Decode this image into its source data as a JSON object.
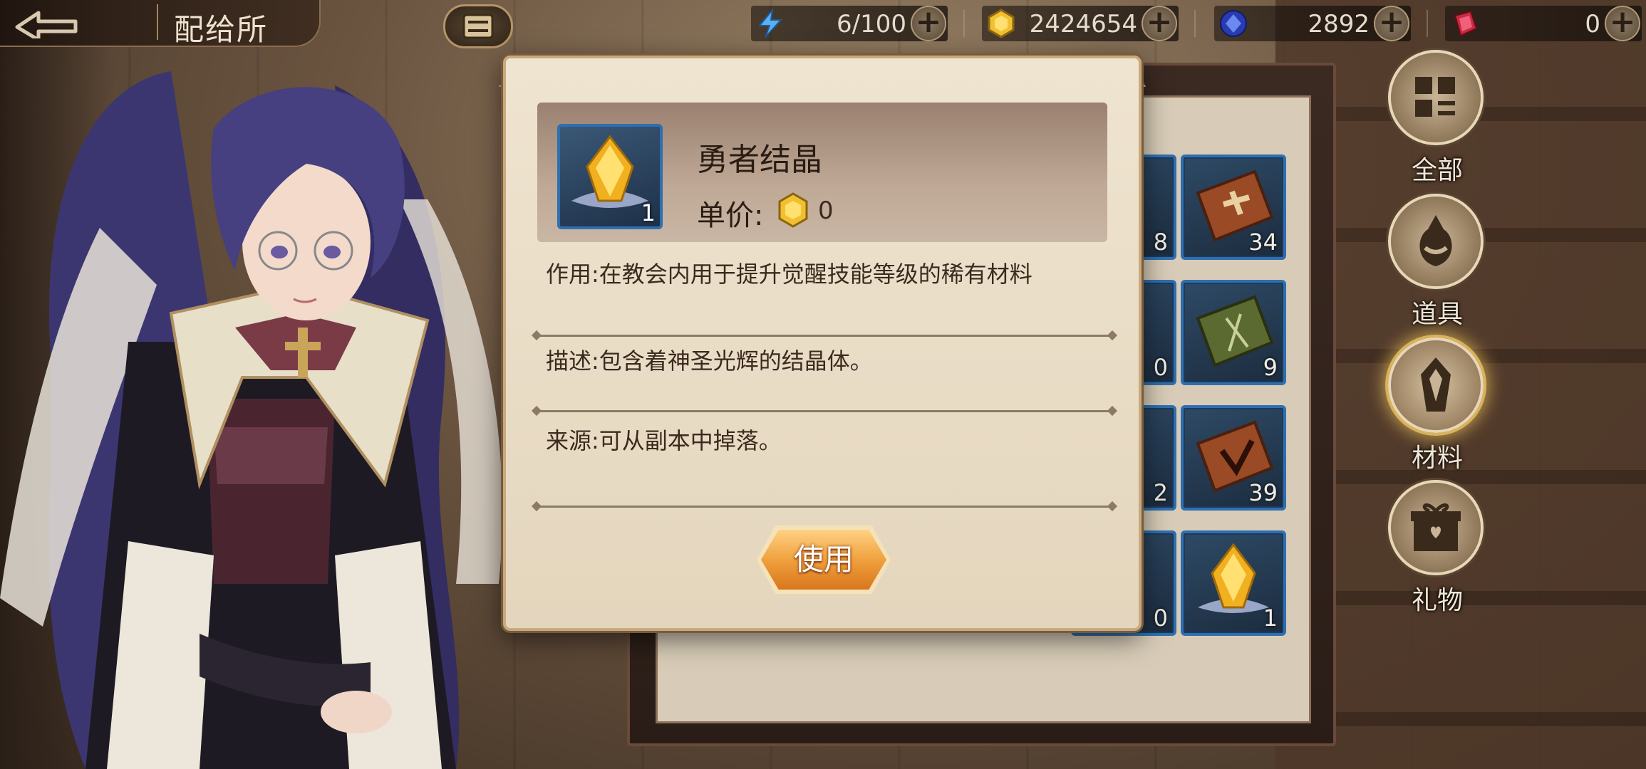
{
  "header": {
    "title": "配给所"
  },
  "resources": [
    {
      "icon": "energy-icon",
      "value": "6/100"
    },
    {
      "icon": "gold-coin-icon",
      "value": "2424654"
    },
    {
      "icon": "blue-gem-icon",
      "value": "2892"
    },
    {
      "icon": "red-crystal-icon",
      "value": "0"
    }
  ],
  "inventory": {
    "items": [
      {
        "icon": "item-icon",
        "qty": "8"
      },
      {
        "icon": "cross-book-icon",
        "qty": "34"
      },
      {
        "icon": "item-icon",
        "qty": "0"
      },
      {
        "icon": "green-book-icon",
        "qty": "9"
      },
      {
        "icon": "item-icon",
        "qty": "2"
      },
      {
        "icon": "rune-book-icon",
        "qty": "39"
      },
      {
        "icon": "item-icon",
        "qty": "0"
      },
      {
        "icon": "crystal-icon",
        "qty": "1"
      }
    ]
  },
  "nav": {
    "items": [
      {
        "label": "全部",
        "icon": "grid-icon",
        "active": false
      },
      {
        "label": "道具",
        "icon": "potion-icon",
        "active": false
      },
      {
        "label": "材料",
        "icon": "crystal-icon",
        "active": true
      },
      {
        "label": "礼物",
        "icon": "gift-icon",
        "active": false
      }
    ]
  },
  "modal": {
    "item_name": "勇者结晶",
    "item_qty": "1",
    "price_label": "单价:",
    "price_value": "0",
    "effect": "作用:在教会内用于提升觉醒技能等级的稀有材料",
    "description": "描述:包含着神圣光辉的结晶体。",
    "source": "来源:可从副本中掉落。",
    "use_label": "使用"
  },
  "colors": {
    "item_border": "#2f6fb0",
    "use_button": "#f0a13e",
    "modal_bg": "#efe4d0"
  }
}
